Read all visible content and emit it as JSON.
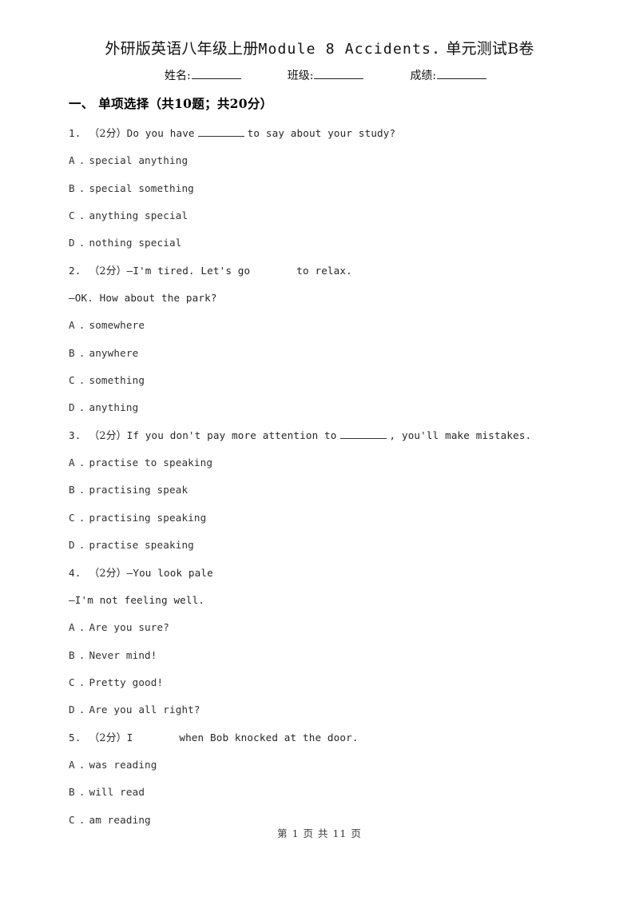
{
  "document": {
    "title_cn_lead": "外研版英语八年级上册",
    "title_latin": "Module 8 Accidents.",
    "title_cn_tail": "单元测试B卷",
    "title_full": "外研版英语八年级上册Module 8 Accidents. 单元测试B卷"
  },
  "identity": {
    "fields": [
      {
        "label": "姓名:",
        "value": ""
      },
      {
        "label": "班级:",
        "value": ""
      },
      {
        "label": "成绩:",
        "value": ""
      }
    ]
  },
  "section": {
    "heading": "一、 单项选择（共10题；共20分）"
  },
  "questions": [
    {
      "number": "1.",
      "marks": "（2分）",
      "stem_before": "Do you have",
      "blank_type": "underline",
      "stem_after": "to say about your study?",
      "continuation": null,
      "options": [
        {
          "letter": "A",
          "text": "special anything"
        },
        {
          "letter": "B",
          "text": "special something"
        },
        {
          "letter": "C",
          "text": "anything special"
        },
        {
          "letter": "D",
          "text": "nothing special"
        }
      ]
    },
    {
      "number": "2.",
      "marks": "（2分）",
      "stem_before": "—I'm tired. Let's go",
      "blank_type": "gap",
      "stem_after": "to relax.",
      "continuation": "—OK. How about the park?",
      "options": [
        {
          "letter": "A",
          "text": "somewhere"
        },
        {
          "letter": "B",
          "text": "anywhere"
        },
        {
          "letter": "C",
          "text": "something"
        },
        {
          "letter": "D",
          "text": "anything"
        }
      ]
    },
    {
      "number": "3.",
      "marks": "（2分）",
      "stem_before": "If you don't pay more attention to",
      "blank_type": "underline",
      "stem_after": ", you'll make mistakes.",
      "continuation": null,
      "options": [
        {
          "letter": "A",
          "text": "practise to speaking"
        },
        {
          "letter": "B",
          "text": "practising speak"
        },
        {
          "letter": "C",
          "text": "practising speaking"
        },
        {
          "letter": "D",
          "text": "practise speaking"
        }
      ]
    },
    {
      "number": "4.",
      "marks": "（2分）",
      "stem_before": "—You look pale",
      "blank_type": "none",
      "stem_after": "",
      "continuation": "—I'm not feeling well.",
      "options": [
        {
          "letter": "A",
          "text": "Are you sure?"
        },
        {
          "letter": "B",
          "text": "Never mind!"
        },
        {
          "letter": "C",
          "text": "Pretty good!"
        },
        {
          "letter": "D",
          "text": "Are you all right?"
        }
      ]
    },
    {
      "number": "5.",
      "marks": "（2分）",
      "stem_before": "I",
      "blank_type": "gap",
      "stem_after": "when Bob knocked at the door.",
      "continuation": null,
      "options": [
        {
          "letter": "A",
          "text": "was reading"
        },
        {
          "letter": "B",
          "text": "will read"
        },
        {
          "letter": "C",
          "text": "am reading"
        }
      ]
    }
  ],
  "footer": {
    "text": "第 1 页 共 11 页"
  }
}
